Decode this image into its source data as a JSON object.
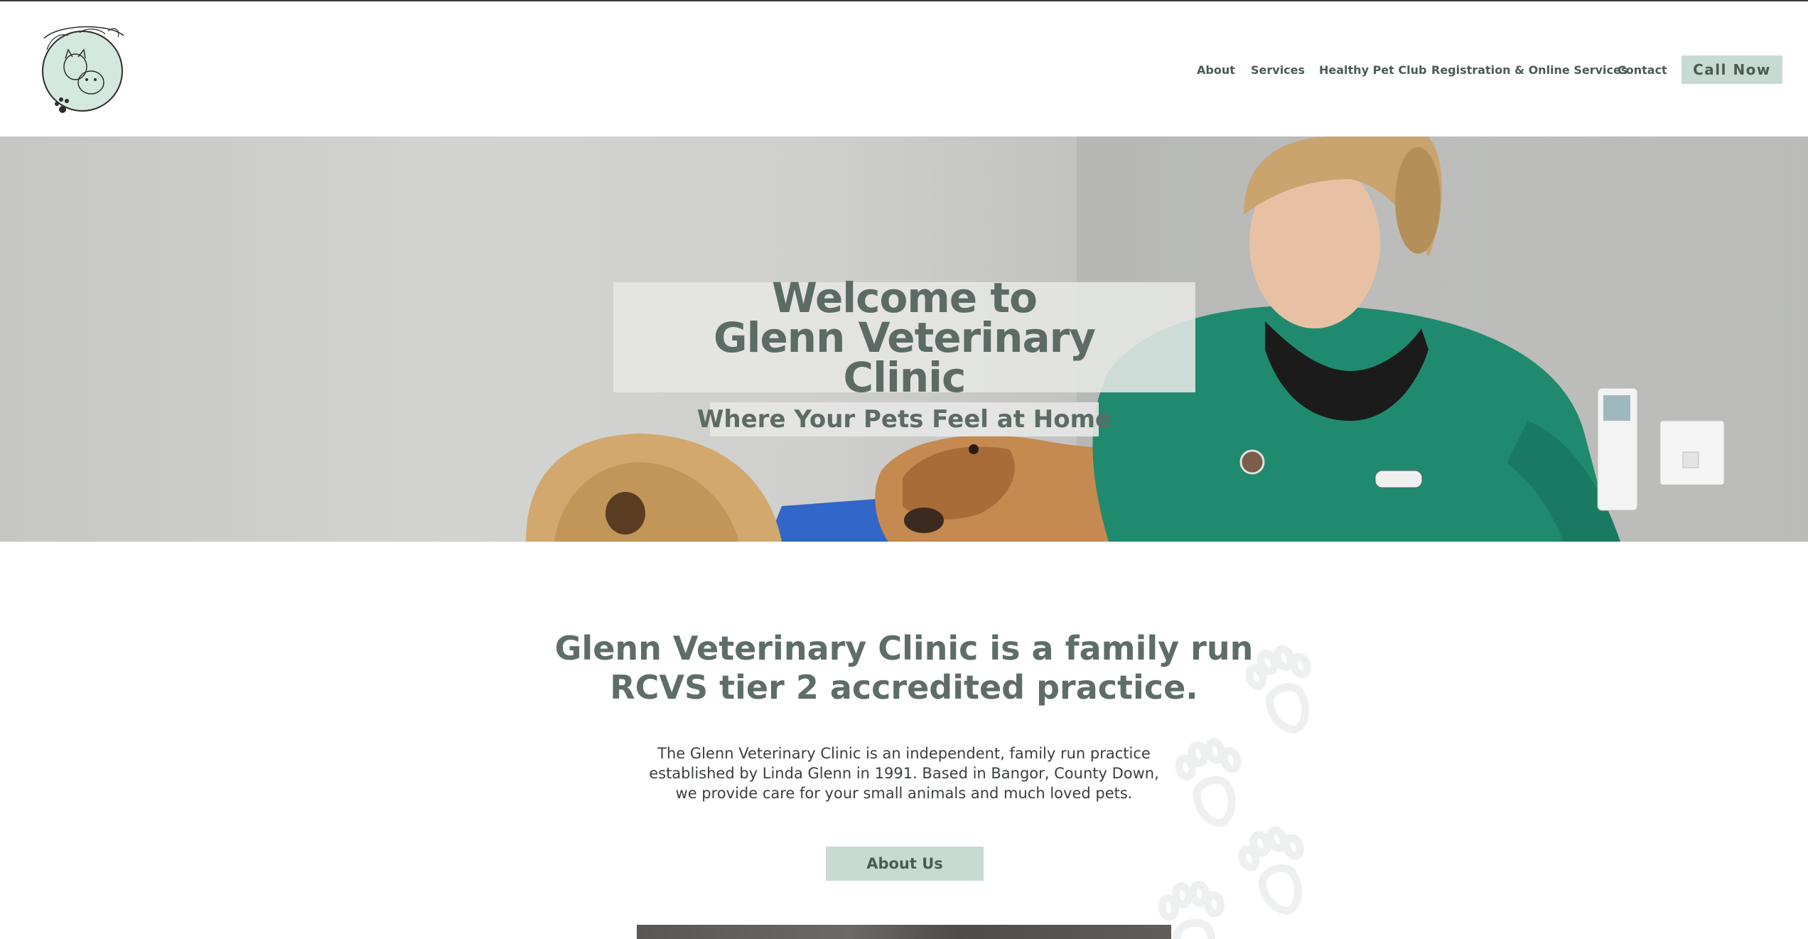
{
  "header": {
    "logo_alt": "Glenn Veterinary Clinic",
    "nav": [
      {
        "label": "About"
      },
      {
        "label": "Services"
      },
      {
        "label": "Healthy Pet Club"
      },
      {
        "label": "Registration & Online Services"
      },
      {
        "label": "Contact"
      }
    ],
    "cta_label": "Call Now"
  },
  "hero": {
    "title": "Welcome to Glenn Veterinary Clinic",
    "subtitle": "Where Your Pets Feel at Home"
  },
  "intro": {
    "heading": "Glenn Veterinary Clinic is a family run RCVS tier 2 accredited practice.",
    "text": "The Glenn Veterinary Clinic is an independent, family run practice established by Linda Glenn in 1991.  Based in Bangor, County Down, we provide care for your small animals and much loved pets.",
    "button_label": "About Us"
  },
  "colors": {
    "accent": "#c7dbd3",
    "text_dark_green": "#5e6d67",
    "nurse_scrubs": "#1f8a6e"
  }
}
